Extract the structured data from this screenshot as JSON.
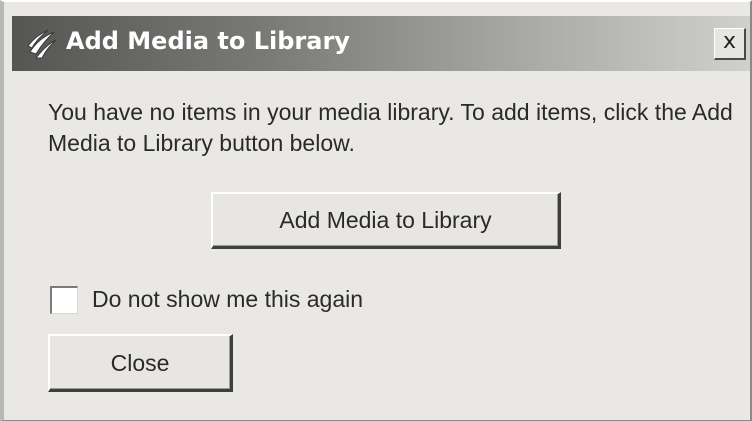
{
  "dialog": {
    "title": "Add Media to Library",
    "title_icon": "media-player-logo-icon",
    "close_glyph": "x",
    "message": "You have no items in your media library. To add items, click the Add Media to Library button below.",
    "add_button_label": "Add Media to Library",
    "checkbox_label": "Do not show me this again",
    "checkbox_checked": false,
    "close_button_label": "Close"
  }
}
